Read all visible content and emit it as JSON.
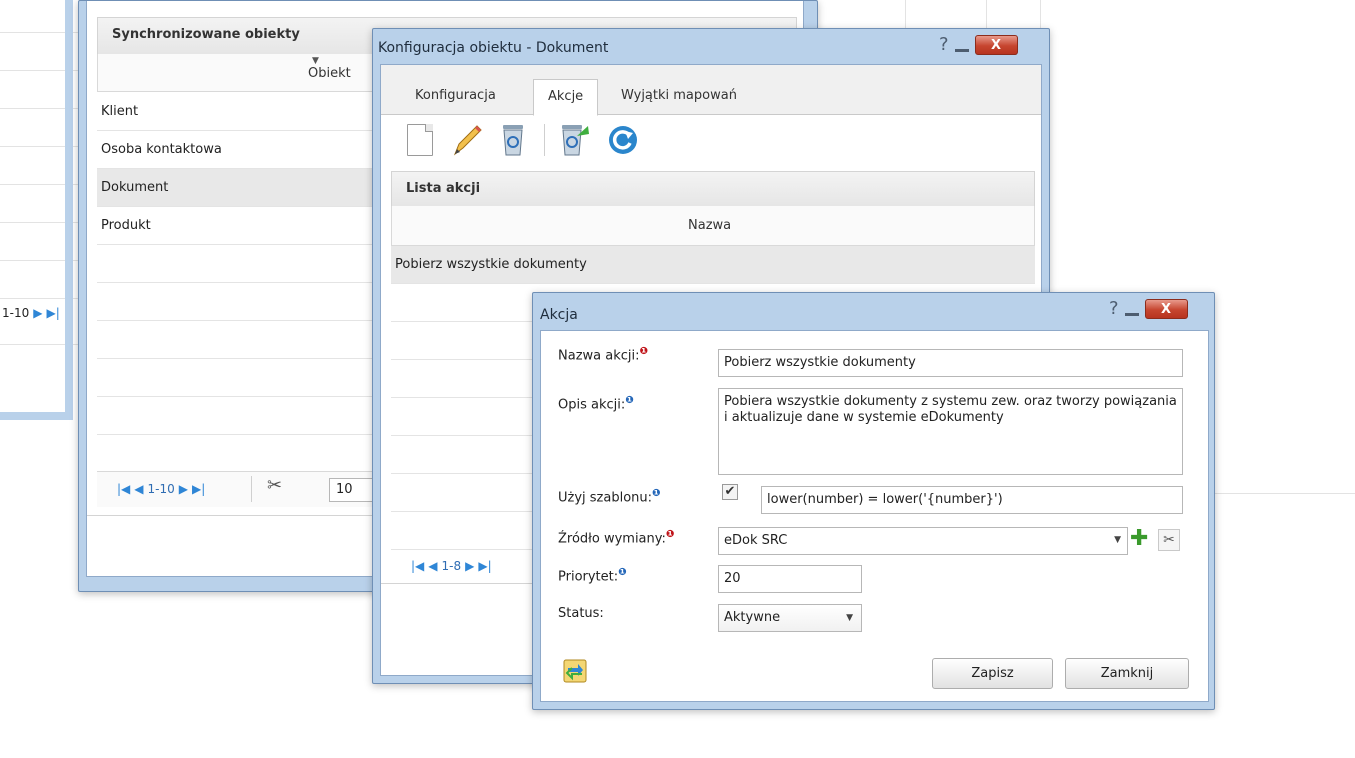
{
  "background_window": {
    "panel_title": "Synchronizowane obiekty",
    "column_header": "Obiekt",
    "rows": [
      "Klient",
      "Osoba kontaktowa",
      "Dokument",
      "Produkt"
    ],
    "selected_row": "Dokument",
    "pager_text": "1-10",
    "page_size": "10",
    "left_pager_text": "1-10"
  },
  "config_window": {
    "title": "Konfiguracja obiektu - Dokument",
    "tabs": [
      "Konfiguracja",
      "Akcje",
      "Wyjątki mapowań"
    ],
    "active_tab": "Akcje",
    "toolbar_icons": [
      "new-document-icon",
      "edit-pencil-icon",
      "delete-recycle-icon",
      "restore-recycle-icon",
      "refresh-icon"
    ],
    "list_title": "Lista akcji",
    "column_header": "Nazwa",
    "rows": [
      "Pobierz wszystkie dokumenty"
    ],
    "pager_text": "1-8"
  },
  "action_dialog": {
    "title": "Akcja",
    "labels": {
      "name": "Nazwa akcji:",
      "description": "Opis akcji:",
      "template": "Użyj szablonu:",
      "source": "Źródło wymiany:",
      "priority": "Priorytet:",
      "status": "Status:"
    },
    "values": {
      "name": "Pobierz wszystkie dokumenty",
      "description": "Pobiera wszystkie dokumenty z systemu zew. oraz tworzy powiązania i aktualizuje dane w systemie eDokumenty",
      "template_checked": true,
      "template_expression": "lower(number) = lower('{number}')",
      "source": "eDok SRC",
      "priority": "20",
      "status": "Aktywne"
    },
    "buttons": {
      "save": "Zapisz",
      "close": "Zamknij"
    }
  },
  "colors": {
    "title_bar": "#b9d1ea",
    "close_button": "#c6452f",
    "required_marker": "#c0141a",
    "info_marker": "#2366b8",
    "link_blue": "#2f6db3"
  }
}
